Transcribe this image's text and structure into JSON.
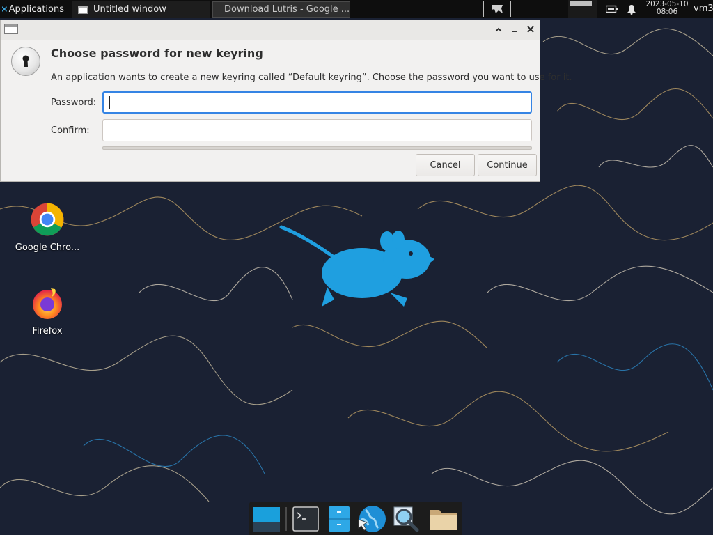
{
  "top_panel": {
    "applications_label": "Applications",
    "tasks": [
      {
        "label": "Untitled window"
      },
      {
        "label": "Download Lutris - Google ..."
      }
    ],
    "clock": {
      "date": "2023-05-10",
      "time": "08:06"
    },
    "user": "vm3"
  },
  "dialog": {
    "heading": "Choose password for new keyring",
    "description": "An application wants to create a new keyring called “Default keyring”. Choose the password you want to use for it.",
    "password_label": "Password:",
    "password_value": "",
    "confirm_label": "Confirm:",
    "confirm_value": "",
    "cancel_label": "Cancel",
    "continue_label": "Continue",
    "window_controls": [
      "maximize",
      "minimize",
      "close"
    ]
  },
  "desktop_icons": [
    {
      "label": "Google Chro...",
      "icon": "chrome-icon"
    },
    {
      "label": "Firefox",
      "icon": "firefox-icon"
    }
  ],
  "dock_items": [
    "show-desktop-icon",
    "terminal-icon",
    "file-manager-icon",
    "web-browser-icon",
    "app-finder-icon",
    "folder-icon"
  ],
  "colors": {
    "focus_border": "#3584e4",
    "wallpaper_bg": "#1b2233",
    "mouse_logo": "#1f9fe0",
    "panel_bg": "#0e0e0e"
  }
}
